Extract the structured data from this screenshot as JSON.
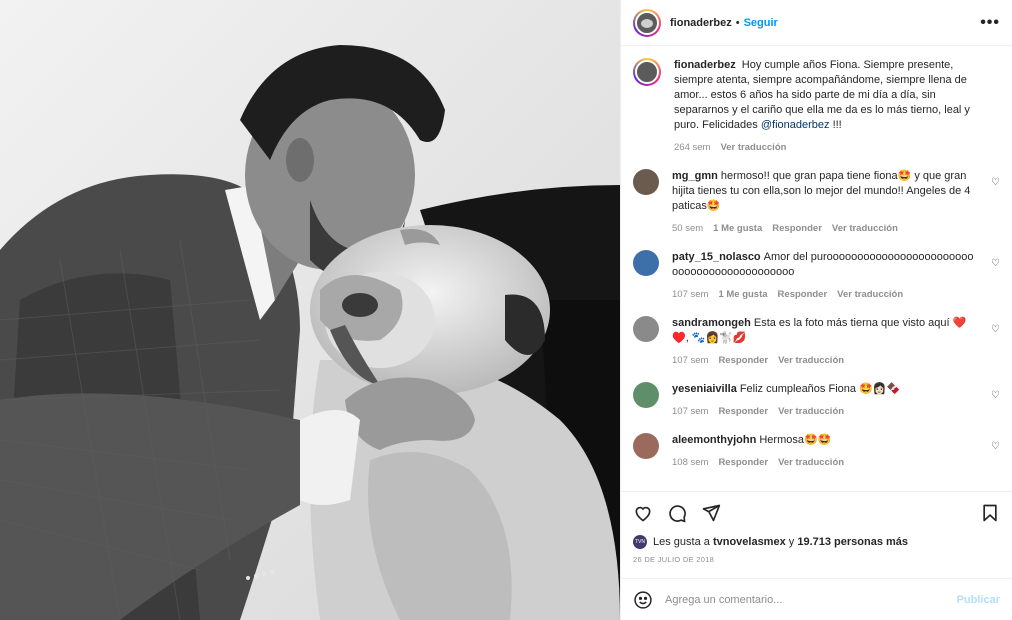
{
  "post": {
    "username": "fionaderbez",
    "follow_label": "Seguir",
    "separator": "•",
    "more_label": "•••"
  },
  "caption": {
    "username": "fionaderbez",
    "text": "Hoy cumple años Fiona. Siempre presente, siempre atenta, siempre acompañándome, siempre llena de amor... estos 6 años ha sido parte de mi día a día, sin separarnos y el cariño que ella me da es lo más tierno, leal y puro. Felicidades",
    "mention": "@fionaderbez",
    "tail": "!!!",
    "time": "264 sem",
    "translate": "Ver traducción"
  },
  "comments": [
    {
      "username": "mg_gmn",
      "text": "hermoso!! que gran papa tiene fiona🤩 y que gran hijita tienes tu con ella,son lo mejor del mundo!! Angeles de 4 paticas🤩",
      "time": "50 sem",
      "likes": "1 Me gusta",
      "reply": "Responder",
      "translate": "Ver traducción",
      "avatar_color": "#6b5a4e"
    },
    {
      "username": "paty_15_nolasco",
      "text": "Amor del puroooooooooooooooooooooooooooooooooooooooooooo",
      "time": "107 sem",
      "likes": "1 Me gusta",
      "reply": "Responder",
      "translate": "Ver traducción",
      "avatar_color": "#3d6fa8"
    },
    {
      "username": "sandramongeh",
      "text": "Esta es la foto más tierna que visto aquí ❤️♥️, 🐾👩🐩💋",
      "time": "107 sem",
      "likes": "",
      "reply": "Responder",
      "translate": "Ver traducción",
      "avatar_color": "#8a8a8a"
    },
    {
      "username": "yeseniaivilla",
      "text": "Feliz cumpleaños Fiona 🤩👩🏻🍫",
      "time": "107 sem",
      "likes": "",
      "reply": "Responder",
      "translate": "Ver traducción",
      "avatar_color": "#5e8f6a"
    },
    {
      "username": "aleemonthyjohn",
      "text": "Hermosa🤩🤩",
      "time": "108 sem",
      "likes": "",
      "reply": "Responder",
      "translate": "Ver traducción",
      "avatar_color": "#9a6b5c"
    }
  ],
  "likes_line": {
    "avatar_text": "TVN",
    "prefix": "Les gusta a",
    "user": "tvnovelasmex",
    "middle": "y",
    "count": "19.713 personas más"
  },
  "date": "26 DE JULIO DE 2018",
  "add_comment": {
    "placeholder": "Agrega un comentario...",
    "publish_label": "Publicar"
  },
  "icons": {
    "heart": "heart-icon",
    "comment": "comment-icon",
    "share": "share-icon",
    "save": "bookmark-icon",
    "emoji": "emoji-icon"
  },
  "colors": {
    "accent": "#0095f6",
    "mention": "#00376b",
    "muted": "#8e8e8e",
    "publish_disabled": "#b2dffc"
  }
}
